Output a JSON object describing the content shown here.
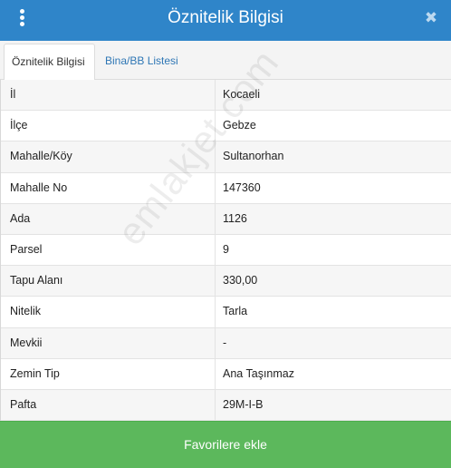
{
  "header": {
    "title": "Öznitelik Bilgisi",
    "menu_icon": "vertical-dots-icon",
    "close_icon": "close-icon",
    "close_glyph": "✖"
  },
  "tabs": [
    {
      "label": "Öznitelik Bilgisi",
      "active": true
    },
    {
      "label": "Bina/BB Listesi",
      "active": false
    }
  ],
  "rows": [
    {
      "label": "İl",
      "value": "Kocaeli"
    },
    {
      "label": "İlçe",
      "value": "Gebze"
    },
    {
      "label": "Mahalle/Köy",
      "value": "Sultanorhan"
    },
    {
      "label": "Mahalle No",
      "value": "147360"
    },
    {
      "label": "Ada",
      "value": "1126"
    },
    {
      "label": "Parsel",
      "value": "9"
    },
    {
      "label": "Tapu Alanı",
      "value": "330,00"
    },
    {
      "label": "Nitelik",
      "value": "Tarla"
    },
    {
      "label": "Mevkii",
      "value": "-"
    },
    {
      "label": "Zemin Tip",
      "value": "Ana Taşınmaz"
    },
    {
      "label": "Pafta",
      "value": "29M-I-B"
    }
  ],
  "footer": {
    "button_label": "Favorilere ekle"
  },
  "watermark": "emlakjet.com",
  "colors": {
    "header": "#2f85c9",
    "button": "#5cb85c",
    "tab_link": "#2f77b5"
  }
}
